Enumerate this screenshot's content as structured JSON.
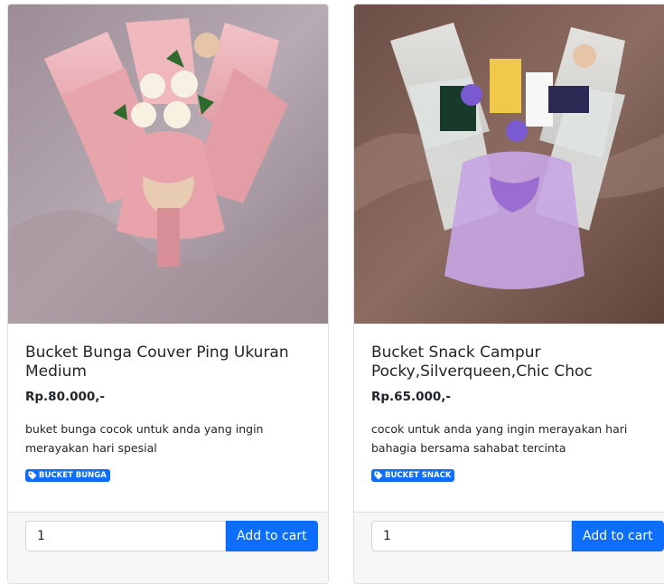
{
  "products": [
    {
      "name": "Bucket Bunga Couver Ping Ukuran Medium",
      "price": "Rp.80.000,-",
      "description": "buket bunga cocok untuk anda yang ingin merayakan hari spesial",
      "category": "BUCKET BUNGA",
      "quantity": "1",
      "add_label": "Add to cart"
    },
    {
      "name": "Bucket Snack Campur Pocky,Silverqueen,Chic Choc",
      "price": "Rp.65.000,-",
      "description": "cocok untuk anda yang ingin merayakan hari bahagia bersama sahabat tercinta",
      "category": "BUCKET SNACK",
      "quantity": "1",
      "add_label": "Add to cart"
    }
  ],
  "colors": {
    "primary": "#0d6efd",
    "pink_wrap": "#e9a9b0",
    "lilac_wrap": "#c8a6e6"
  }
}
